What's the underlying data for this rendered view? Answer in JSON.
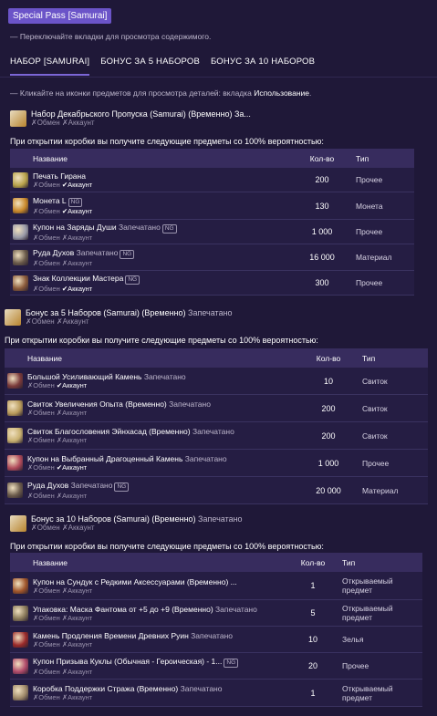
{
  "title": "Special Pass [Samurai]",
  "hint_tabs": "— Переключайте вкладки для просмотра содержимого.",
  "tabs": [
    "НАБОР [SAMURAI]",
    "БОНУС ЗА 5 НАБОРОВ",
    "БОНУС ЗА 10 НАБОРОВ"
  ],
  "hint_items_prefix": "— Кликайте на иконки предметов для просмотра деталей: вкладка",
  "hint_items_bold": "Использование",
  "hint_items_suffix": ".",
  "chance_text": "При открытии коробки вы получите следующие предметы со 100% вероятностью:",
  "headers": {
    "name": "Название",
    "qty": "Кол-во",
    "type": "Тип"
  },
  "tag_exchange": "✗Обмен",
  "tag_account_no": "✗Аккаунт",
  "tag_account_yes": "✔Аккаунт",
  "seal_word": "Запечатано",
  "ng_badge": "NG",
  "boxes": [
    {
      "name": "Набор Декабрьского Пропуска (Samurai) (Временно) За...",
      "sealed": false,
      "account_ok": false,
      "items": [
        {
          "name": "Печать Гирана",
          "sealed": false,
          "ng": false,
          "account_ok": true,
          "qty": "200",
          "type": "Прочее",
          "icon": "seal-icon",
          "color": "#b8a24a"
        },
        {
          "name": "Монета L",
          "sealed": false,
          "ng": true,
          "account_ok": true,
          "qty": "130",
          "type": "Монета",
          "icon": "coin-icon",
          "color": "#c9882a"
        },
        {
          "name": "Купон на Заряды Души",
          "sealed": true,
          "ng": true,
          "account_ok": false,
          "qty": "1 000",
          "type": "Прочее",
          "icon": "coupon-icon",
          "color": "#9a9aa8"
        },
        {
          "name": "Руда Духов",
          "sealed": true,
          "ng": true,
          "account_ok": false,
          "qty": "16 000",
          "type": "Материал",
          "icon": "ore-icon",
          "color": "#6a5a4a"
        },
        {
          "name": "Знак Коллекции Мастера",
          "sealed": false,
          "ng": true,
          "account_ok": true,
          "qty": "300",
          "type": "Прочее",
          "icon": "mark-icon",
          "color": "#8a5a3a"
        }
      ]
    },
    {
      "name": "Бонус за 5 Наборов (Samurai) (Временно)",
      "sealed": true,
      "account_ok": false,
      "items": [
        {
          "name": "Большой Усиливающий Камень",
          "sealed": true,
          "ng": false,
          "account_ok": true,
          "qty": "10",
          "type": "Свиток",
          "icon": "stone-icon",
          "color": "#7a3a3a"
        },
        {
          "name": "Свиток Увеличения Опыта (Временно)",
          "sealed": true,
          "ng": false,
          "account_ok": false,
          "qty": "200",
          "type": "Свиток",
          "icon": "scroll-icon",
          "color": "#b89a5a"
        },
        {
          "name": "Свиток Благословения Эйнхасад (Временно)",
          "sealed": true,
          "ng": false,
          "account_ok": false,
          "qty": "200",
          "type": "Свиток",
          "icon": "scroll-icon",
          "color": "#c8b070"
        },
        {
          "name": "Купон на Выбранный Драгоценный Камень",
          "sealed": true,
          "ng": false,
          "account_ok": true,
          "qty": "1 000",
          "type": "Прочее",
          "icon": "gem-coupon-icon",
          "color": "#b04a5a"
        },
        {
          "name": "Руда Духов",
          "sealed": true,
          "ng": true,
          "account_ok": false,
          "qty": "20 000",
          "type": "Материал",
          "icon": "ore-icon",
          "color": "#6a5a4a"
        }
      ]
    },
    {
      "name": "Бонус за 10 Наборов (Samurai) (Временно)",
      "sealed": true,
      "account_ok": false,
      "items": [
        {
          "name": "Купон на Сундук с Редкими Аксессуарами (Временно) ...",
          "sealed": false,
          "ng": false,
          "account_ok": false,
          "qty": "1",
          "type": "Открываемый предмет",
          "icon": "chest-icon",
          "color": "#a0552a"
        },
        {
          "name": "Упаковка: Маска Фантома от +5 до +9 (Временно)",
          "sealed": true,
          "ng": false,
          "account_ok": false,
          "qty": "5",
          "type": "Открываемый предмет",
          "icon": "package-icon",
          "color": "#8a7a5a"
        },
        {
          "name": "Камень Продления Времени Древних Руин",
          "sealed": true,
          "ng": false,
          "account_ok": false,
          "qty": "10",
          "type": "Зелья",
          "icon": "time-stone-icon",
          "color": "#9a2a2a"
        },
        {
          "name": "Купон Призыва Куклы (Обычная - Героическая) - 1...",
          "sealed": false,
          "ng": true,
          "account_ok": false,
          "qty": "20",
          "type": "Прочее",
          "icon": "doll-coupon-icon",
          "color": "#b04a6a"
        },
        {
          "name": "Коробка Поддержки Стража (Временно)",
          "sealed": true,
          "ng": false,
          "account_ok": false,
          "qty": "1",
          "type": "Открываемый предмет",
          "icon": "box-icon",
          "color": "#a08a6a"
        }
      ]
    }
  ]
}
